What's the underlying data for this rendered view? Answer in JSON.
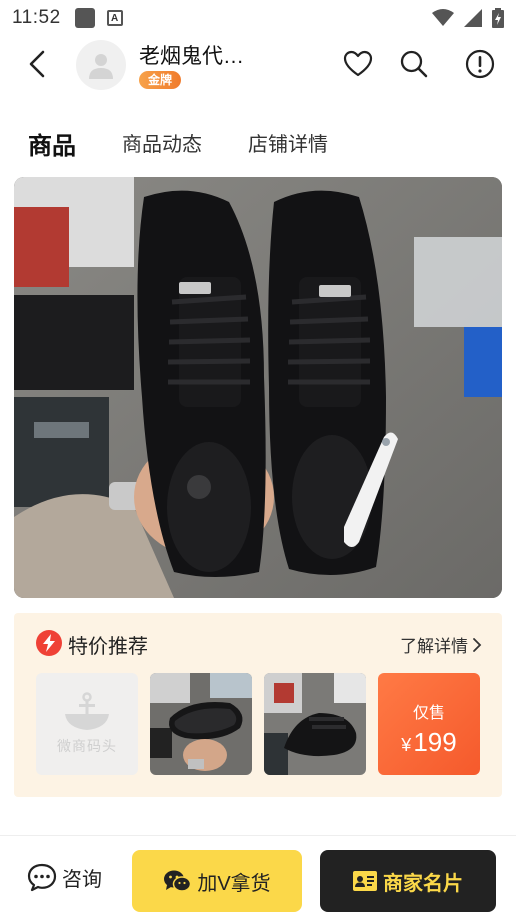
{
  "status_bar": {
    "time": "11:52"
  },
  "header": {
    "shop_name": "老烟鬼代…",
    "badge": "金牌"
  },
  "tabs": [
    {
      "label": "商品",
      "active": true
    },
    {
      "label": "商品动态",
      "active": false
    },
    {
      "label": "店铺详情",
      "active": false
    }
  ],
  "promo": {
    "title": "特价推荐",
    "more": "了解详情",
    "placeholder_text": "微商码头",
    "price_label": "仅售",
    "currency": "¥",
    "price": "199"
  },
  "bottom_bar": {
    "consult": "咨询",
    "add_v": "加V拿货",
    "business_card": "商家名片"
  },
  "colors": {
    "accent_orange": "#f55a2c",
    "gold_badge": "#f07b2c",
    "yellow_button": "#fbd849",
    "dark_button": "#222222",
    "promo_bg": "#fdf3e4"
  },
  "icons": [
    "back-icon",
    "heart-icon",
    "search-icon",
    "info-icon",
    "lightning-icon",
    "chevron-right-icon",
    "chat-icon",
    "wechat-icon",
    "id-card-icon"
  ]
}
